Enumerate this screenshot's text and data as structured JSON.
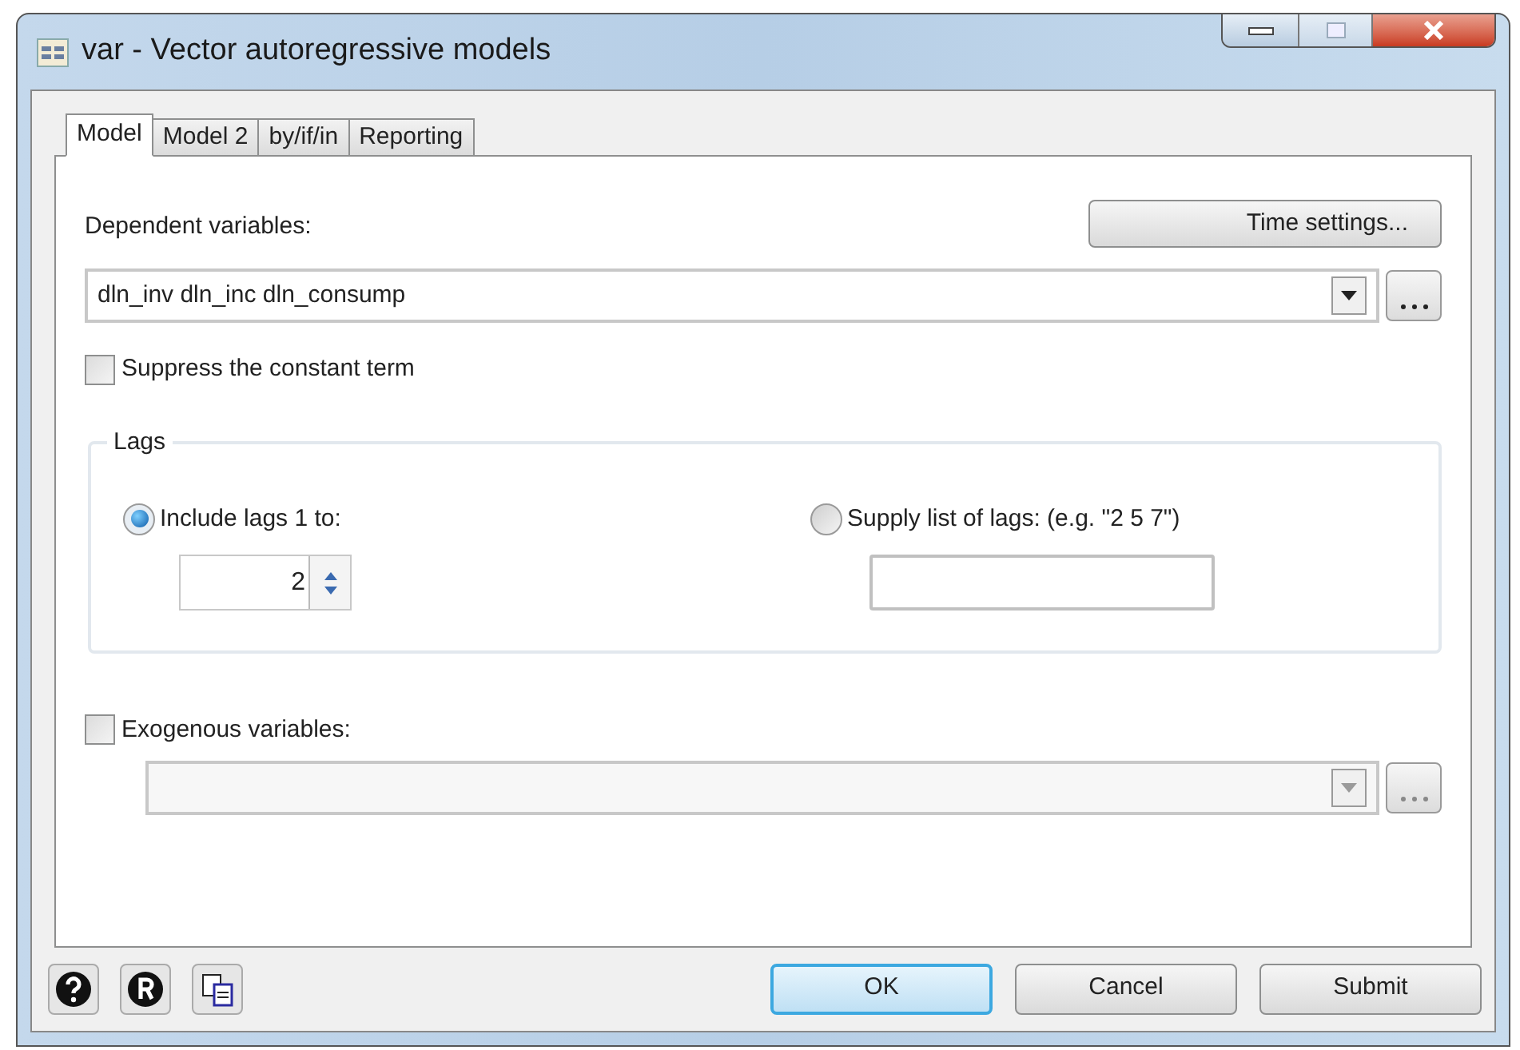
{
  "window": {
    "title": "var - Vector autoregressive models"
  },
  "tabs": [
    {
      "label": "Model",
      "selected": true
    },
    {
      "label": "Model 2",
      "selected": false
    },
    {
      "label": "by/if/in",
      "selected": false
    },
    {
      "label": "Reporting",
      "selected": false
    }
  ],
  "time_settings_button": "Time settings...",
  "dependent": {
    "label": "Dependent variables:",
    "value": "dln_inv dln_inc dln_consump",
    "disabled": false
  },
  "suppress_constant": {
    "label": "Suppress the constant term",
    "checked": false
  },
  "lags": {
    "title": "Lags",
    "options": [
      {
        "label": "Include lags 1 to:",
        "selected": true,
        "kind": "spinner",
        "value": "2"
      },
      {
        "label": "Supply list of lags: (e.g. \"2 5 7\")",
        "selected": false,
        "kind": "text"
      }
    ]
  },
  "exogenous": {
    "label": "Exogenous variables:",
    "checked": false,
    "disabled": true
  },
  "buttons": [
    {
      "label": "OK",
      "default": true
    },
    {
      "label": "Cancel",
      "default": false
    },
    {
      "label": "Submit",
      "default": false
    }
  ]
}
